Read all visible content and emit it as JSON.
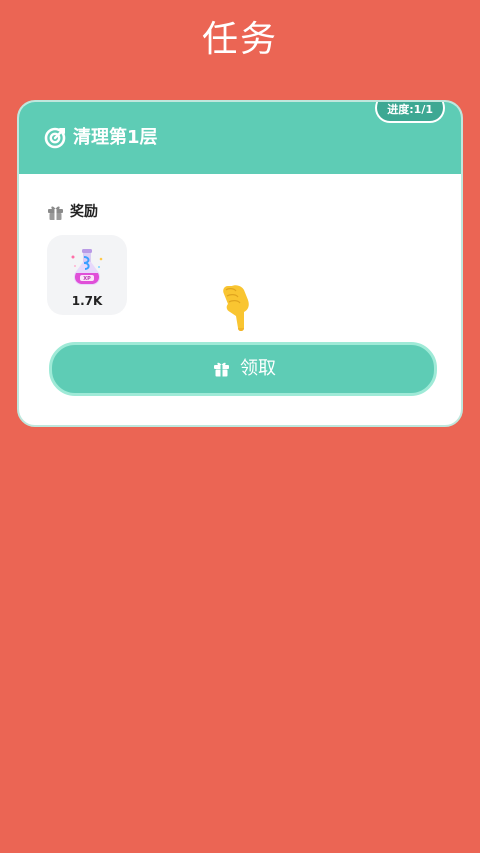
{
  "page": {
    "title": "任务",
    "background_color": "#EB6554"
  },
  "task_card": {
    "title": "清理第1层",
    "header_icon": "target-icon",
    "progress": "进度:1/1",
    "header_color": "#5ECCB5",
    "reward_section": {
      "label": "奖励",
      "icon": "gift-icon",
      "items": [
        {
          "icon": "potion-icon",
          "amount": "1.7K"
        }
      ]
    },
    "claim_button": {
      "label": "领取",
      "icon": "gift-icon",
      "color": "#5ECCB5"
    }
  },
  "overlay": {
    "icon": "hand-pointer-icon"
  }
}
